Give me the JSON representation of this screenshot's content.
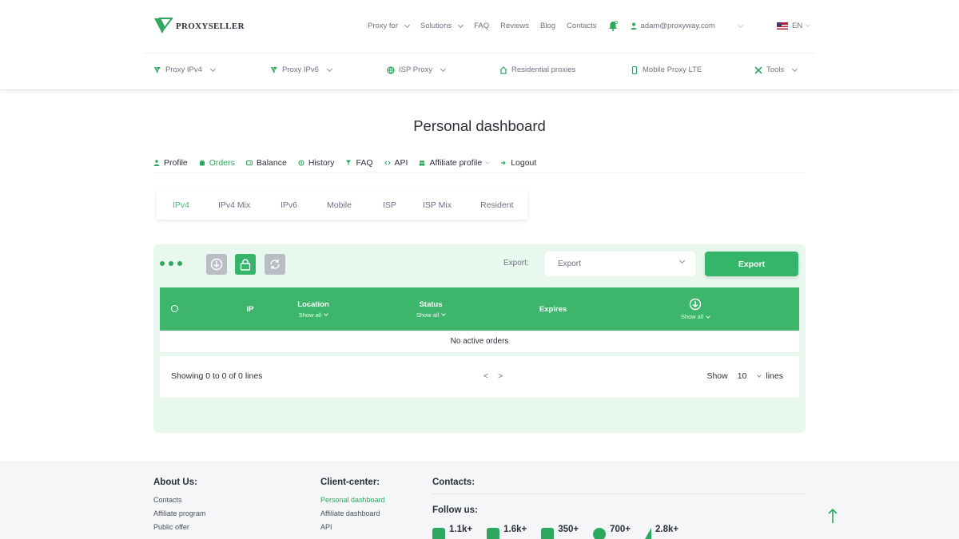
{
  "colors": {
    "brand_green": "#35b56a",
    "header_green": "#3db66b",
    "panel_bg": "#e9f8ee"
  },
  "header": {
    "logo_text": "PROXYSELLER",
    "nav": [
      {
        "label": "Proxy for",
        "dropdown": true
      },
      {
        "label": "Solutions",
        "dropdown": true
      },
      {
        "label": "FAQ"
      },
      {
        "label": "Reviews"
      },
      {
        "label": "Blog"
      },
      {
        "label": "Contacts"
      }
    ],
    "user_email": "adam@proxyway.com",
    "language": "EN"
  },
  "subnav": [
    {
      "label": "Proxy IPv4",
      "icon": "proxy-icon"
    },
    {
      "label": "Proxy IPv6",
      "icon": "proxy-icon"
    },
    {
      "label": "ISP Proxy",
      "icon": "globe-icon"
    },
    {
      "label": "Residential proxies",
      "icon": "home-icon"
    },
    {
      "label": "Mobile Proxy LTE",
      "icon": "phone-icon"
    },
    {
      "label": "Tools",
      "icon": "tools-icon"
    }
  ],
  "dashboard": {
    "title": "Personal dashboard",
    "menu": [
      {
        "label": "Profile"
      },
      {
        "label": "Orders",
        "active": true
      },
      {
        "label": "Balance"
      },
      {
        "label": "History"
      },
      {
        "label": "FAQ"
      },
      {
        "label": "API"
      },
      {
        "label": "Affiliate profile"
      },
      {
        "label": "Logout"
      }
    ],
    "tabs": [
      "IPv4",
      "IPv4 Mix",
      "IPv6",
      "Mobile",
      "ISP",
      "ISP Mix",
      "Resident"
    ],
    "active_tab": "IPv4"
  },
  "orders": {
    "export_label": "Export:",
    "export_select": "Export",
    "export_button": "Export",
    "columns": {
      "ip": "IP",
      "location": "Location",
      "status": "Status",
      "expires": "Expires",
      "show_all": "Show all"
    },
    "empty_text": "No active orders",
    "showing": "Showing 0 to 0 of 0 lines",
    "pager_prev": "<",
    "pager_next": ">",
    "show_label": "Show",
    "page_size": "10",
    "lines_label": "lines"
  },
  "footer": {
    "about_title": "About Us:",
    "about_links": [
      "Contacts",
      "Affiliate program",
      "Public offer"
    ],
    "client_title": "Client-center:",
    "client_links": [
      "Personal dashboard",
      "Affiliate dashboard",
      "API"
    ],
    "contacts_title": "Contacts:",
    "follow_title": "Follow us:",
    "socials": [
      {
        "icon": "facebook-icon",
        "count": "1.1k+"
      },
      {
        "icon": "youtube-icon",
        "count": "1.6k+"
      },
      {
        "icon": "discord-icon",
        "count": "350+"
      },
      {
        "icon": "whatsapp-icon",
        "count": "700+"
      },
      {
        "icon": "telegram-icon",
        "count": "2.8k+"
      }
    ]
  }
}
